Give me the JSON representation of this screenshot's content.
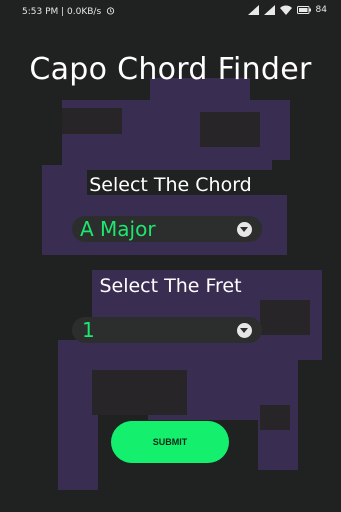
{
  "status_bar": {
    "time_speed": "5:53 PM | 0.0KB/s",
    "battery_text": "84"
  },
  "app": {
    "title": "Capo Chord Finder"
  },
  "chord": {
    "label": "Select The Chord",
    "selected": "A Major"
  },
  "fret": {
    "label": "Select The Fret",
    "selected": "1"
  },
  "actions": {
    "submit_label": "SUBMIT"
  },
  "colors": {
    "background": "#1f2220",
    "accent_green": "#14f06e",
    "value_green": "#1ee66e",
    "art_purple": "#3a2d52"
  },
  "icons": [
    "alarm-icon",
    "signal-icon",
    "wifi-icon",
    "battery-icon",
    "dropdown-arrow-icon"
  ]
}
